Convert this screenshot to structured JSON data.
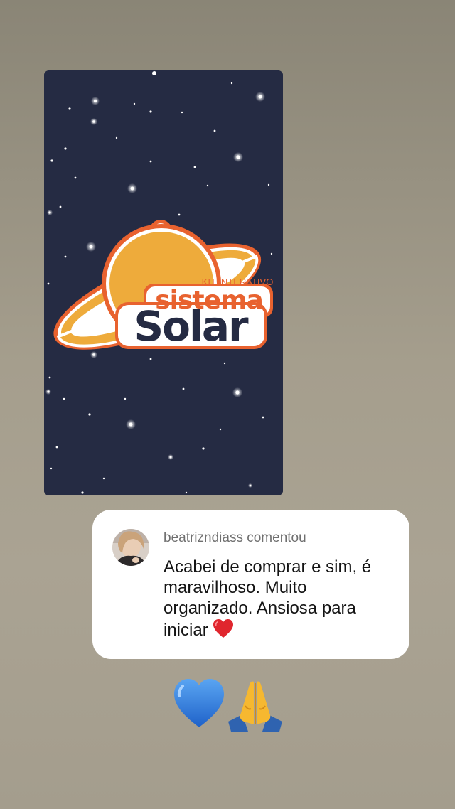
{
  "story": {
    "logo": {
      "kicker": "KIT INTERATIVO",
      "line1": "sistema",
      "line2": "Solar"
    }
  },
  "comment": {
    "username": "beatrizndiass",
    "action": "comentou",
    "text": "Acabei de comprar e sim, é maravilhoso. Muito organizado. Ansiosa para iniciar",
    "emoji_inline": "red-heart"
  },
  "reactions": [
    "blue-heart",
    "folded-hands"
  ],
  "colors": {
    "background": "#a59e8d",
    "story_bg": "#252b43",
    "logo_orange": "#e8622f",
    "planet_yellow": "#eeab3b",
    "logo_navy": "#252b43",
    "bubble": "#ffffff",
    "blue_heart": "#2f7de1",
    "red_heart": "#e0262e"
  }
}
